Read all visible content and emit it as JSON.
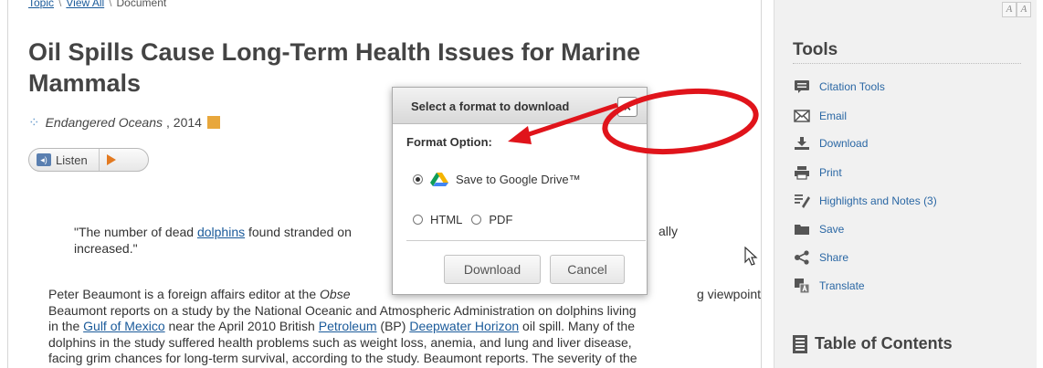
{
  "breadcrumb": {
    "items": [
      "Topic",
      "View All",
      "Document"
    ]
  },
  "article": {
    "title": "Oil Spills Cause Long-Term Health Issues for Marine Mammals",
    "source_name": "Endangered Oceans",
    "source_year": ", 2014",
    "listen_label": "Listen",
    "quote_start": "\"The number of dead ",
    "quote_link": "dolphins",
    "quote_mid": " found stranded on",
    "quote_end": "ally",
    "quote_line2": "increased.\"",
    "body": {
      "p1_start": "Peter Beaumont is a foreign affairs editor at the ",
      "p1_italic": "Obse",
      "p1_tail": "g viewpoint,",
      "line2": "Beaumont reports on a study by the National Oceanic and Atmospheric Administration on dolphins living",
      "line3_a": "in the ",
      "line3_link1": "Gulf of Mexico",
      "line3_b": " near the April 2010 British ",
      "line3_link2": "Petroleum",
      "line3_c": " (BP) ",
      "line3_link3": "Deepwater Horizon",
      "line3_d": " oil spill. Many of the",
      "line4": "dolphins in the study suffered health problems such as weight loss, anemia, and lung and liver disease,",
      "line5": "facing grim chances for long-term survival, according to the study. Beaumont reports. The severity of the"
    }
  },
  "font_size_controls": [
    "A",
    "A"
  ],
  "tools": {
    "title": "Tools",
    "items": [
      {
        "label": "Citation Tools",
        "icon": "citation-icon"
      },
      {
        "label": "Email",
        "icon": "email-icon"
      },
      {
        "label": "Download",
        "icon": "download-icon"
      },
      {
        "label": "Print",
        "icon": "print-icon"
      },
      {
        "label": "Highlights and Notes (3)",
        "icon": "highlight-icon"
      },
      {
        "label": "Save",
        "icon": "folder-icon"
      },
      {
        "label": "Share",
        "icon": "share-icon"
      },
      {
        "label": "Translate",
        "icon": "translate-icon"
      }
    ],
    "icon_color": "#555555",
    "link_color": "#2a67a4"
  },
  "toc": {
    "title": "Table of Contents"
  },
  "dialog": {
    "title": "Select a format to download",
    "close_glyph": "×",
    "format_label": "Format Option:",
    "option_drive": "Save to Google Drive™",
    "option_html": "HTML",
    "option_pdf": "PDF",
    "selected": "drive",
    "download_label": "Download",
    "cancel_label": "Cancel"
  },
  "annotation": {
    "color": "#e0141b"
  }
}
